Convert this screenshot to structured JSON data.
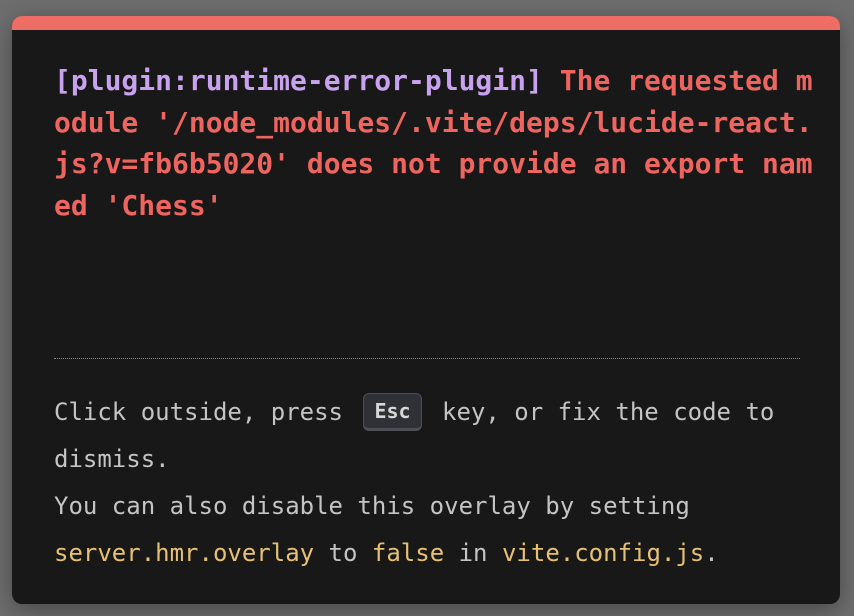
{
  "error": {
    "plugin": "[plugin:runtime-error-plugin]",
    "message": "The requested module '/node_modules/.vite/deps/lucide-react.js?v=fb6b5020' does not provide an export named 'Chess'"
  },
  "tip": {
    "part1": "Click outside, press",
    "key": "Esc",
    "part2": "key, or fix the code to dismiss.",
    "part3": "You can also disable this overlay by setting",
    "code1": "server.hmr.overlay",
    "part4": "to",
    "code2": "false",
    "part5": "in",
    "code3": "vite.config.js",
    "part6": "."
  },
  "colors": {
    "accent_bar": "#ee6e66",
    "plugin": "#c8a2ee",
    "error_text": "#ee6560",
    "code": "#e7c173",
    "background": "#181818"
  }
}
